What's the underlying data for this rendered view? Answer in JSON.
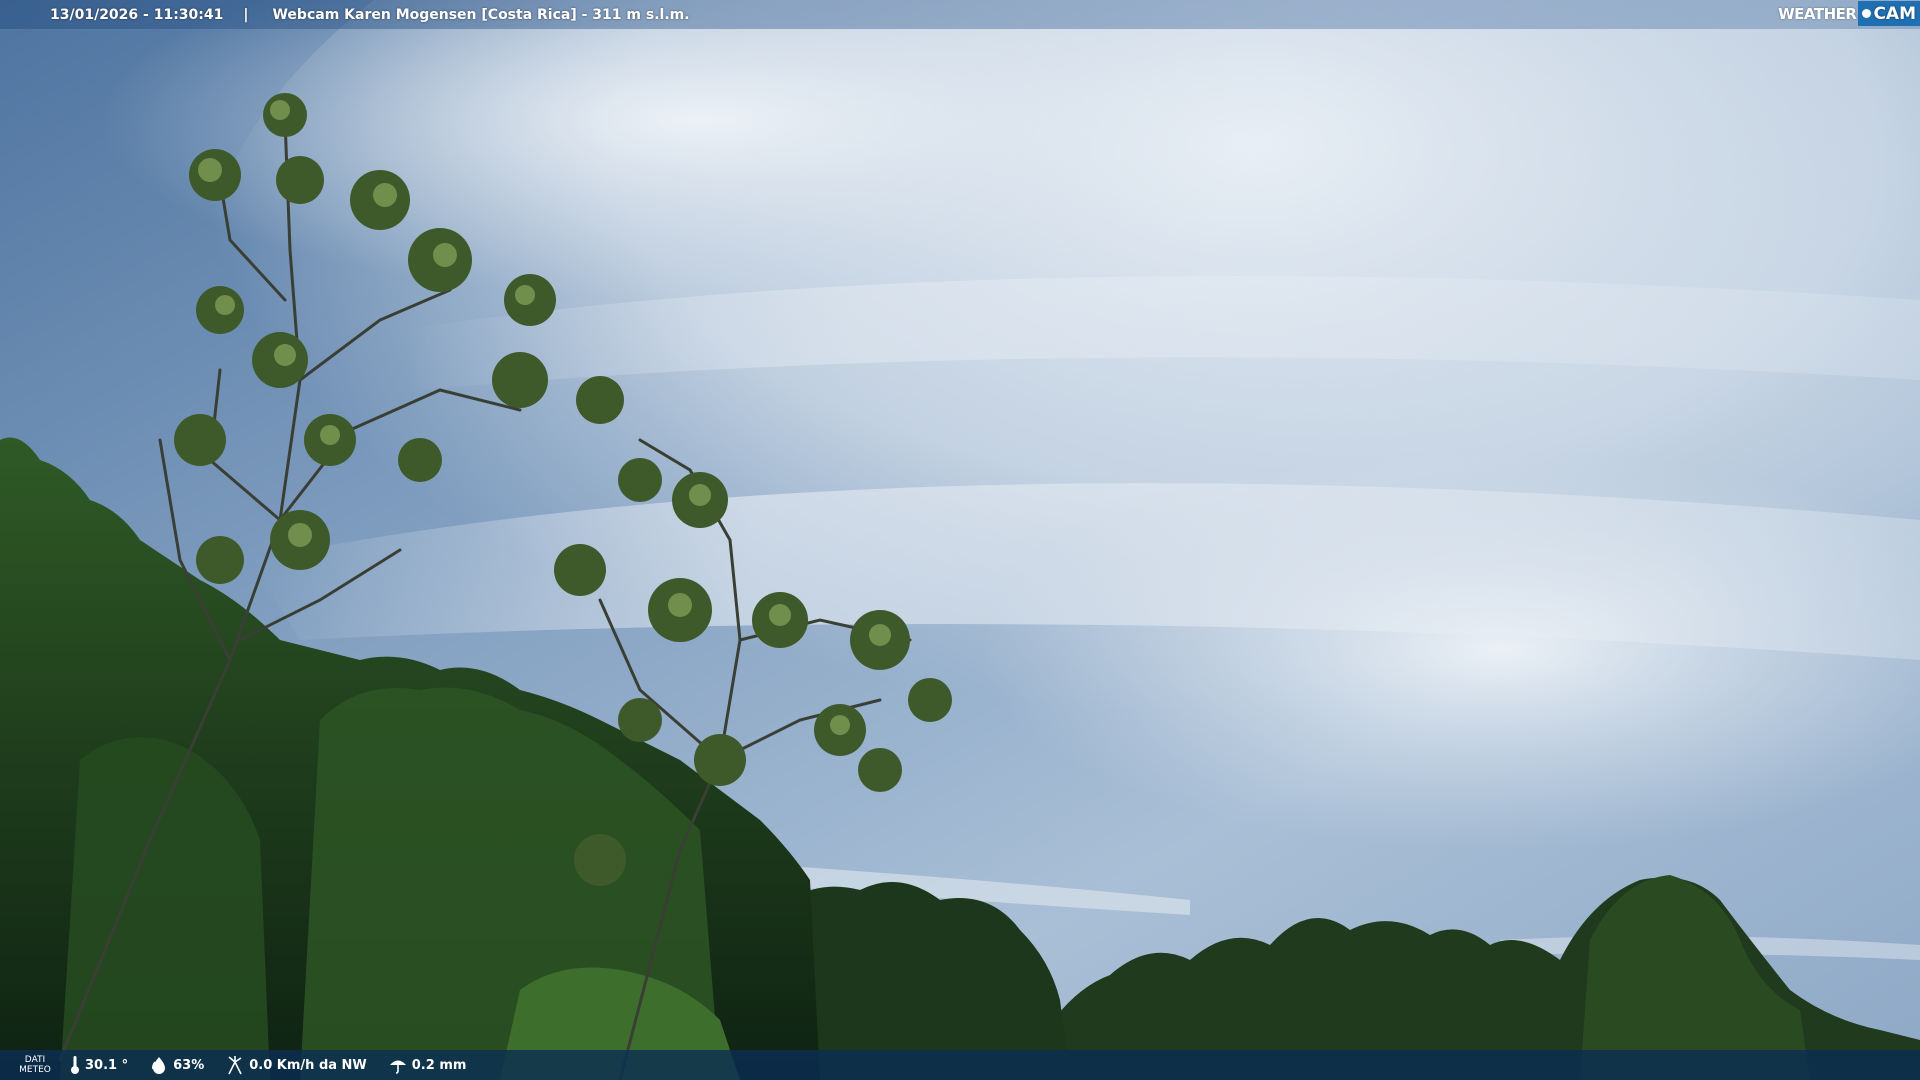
{
  "header": {
    "timestamp": "13/01/2026 - 11:30:41",
    "separator": "|",
    "location": "Webcam Karen Mogensen [Costa Rica]  - 311 m s.l.m."
  },
  "logo": {
    "weather": "WEATHER",
    "cam": "CAM"
  },
  "weather_bar": {
    "label_line1": "DATI",
    "label_line2": "METEO",
    "temperature": "30.1 °",
    "humidity": "63%",
    "wind": "0.0 Km/h da NW",
    "rain": "0.2 mm"
  },
  "colors": {
    "sky_top": "#5b7fa8",
    "cloud": "#dde6ef",
    "foliage_dark": "#18311a",
    "foliage_light": "#4d7a32",
    "logo_blue": "#1f6fb3"
  }
}
